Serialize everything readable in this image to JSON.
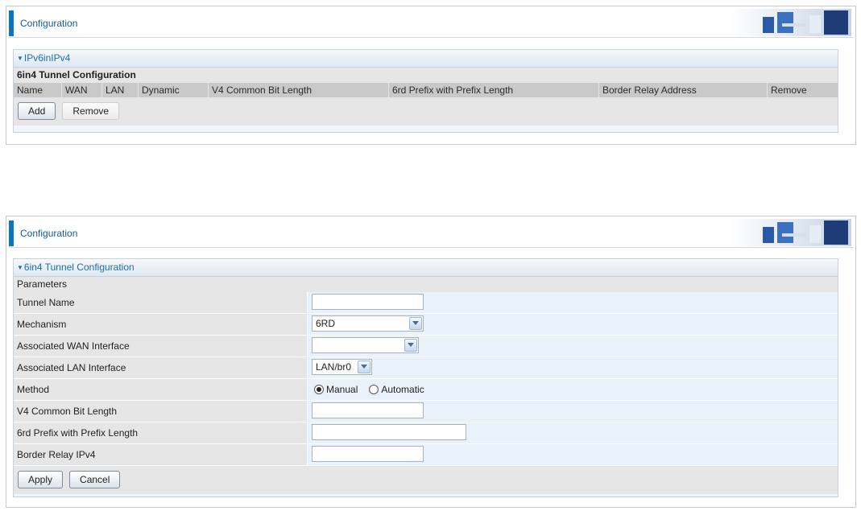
{
  "panel_top": {
    "header_title": "Configuration",
    "section_title": "IPv6inIPv4",
    "sub_header": "6in4 Tunnel Configuration",
    "columns": [
      "Name",
      "WAN",
      "LAN",
      "Dynamic",
      "V4 Common Bit Length",
      "6rd Prefix with Prefix Length",
      "Border Relay Address",
      "Remove"
    ],
    "add_label": "Add",
    "remove_label": "Remove"
  },
  "panel_bottom": {
    "header_title": "Configuration",
    "section_title": "6in4 Tunnel Configuration",
    "sub_header": "Parameters",
    "fields": {
      "tunnel_name": {
        "label": "Tunnel Name",
        "value": ""
      },
      "mechanism": {
        "label": "Mechanism",
        "value": "6RD"
      },
      "wan_interface": {
        "label": "Associated WAN Interface",
        "value": ""
      },
      "lan_interface": {
        "label": "Associated LAN Interface",
        "value": "LAN/br0"
      },
      "method": {
        "label": "Method",
        "option_manual": "Manual",
        "option_automatic": "Automatic",
        "selected": "Manual"
      },
      "v4_common_bit_length": {
        "label": "V4 Common Bit Length",
        "value": ""
      },
      "prefix_length": {
        "label": "6rd Prefix with Prefix Length",
        "value": ""
      },
      "border_relay": {
        "label": "Border Relay IPv4",
        "value": ""
      }
    },
    "apply_label": "Apply",
    "cancel_label": "Cancel"
  },
  "colors": {
    "accent_bar": "#0a74c6",
    "title_text": "#16598f",
    "section_title": "#1f6ea8",
    "row_label_bg": "#e6e6e6",
    "row_value_bg": "#e9f2fb",
    "column_header_bg": "#c9c9c9"
  }
}
